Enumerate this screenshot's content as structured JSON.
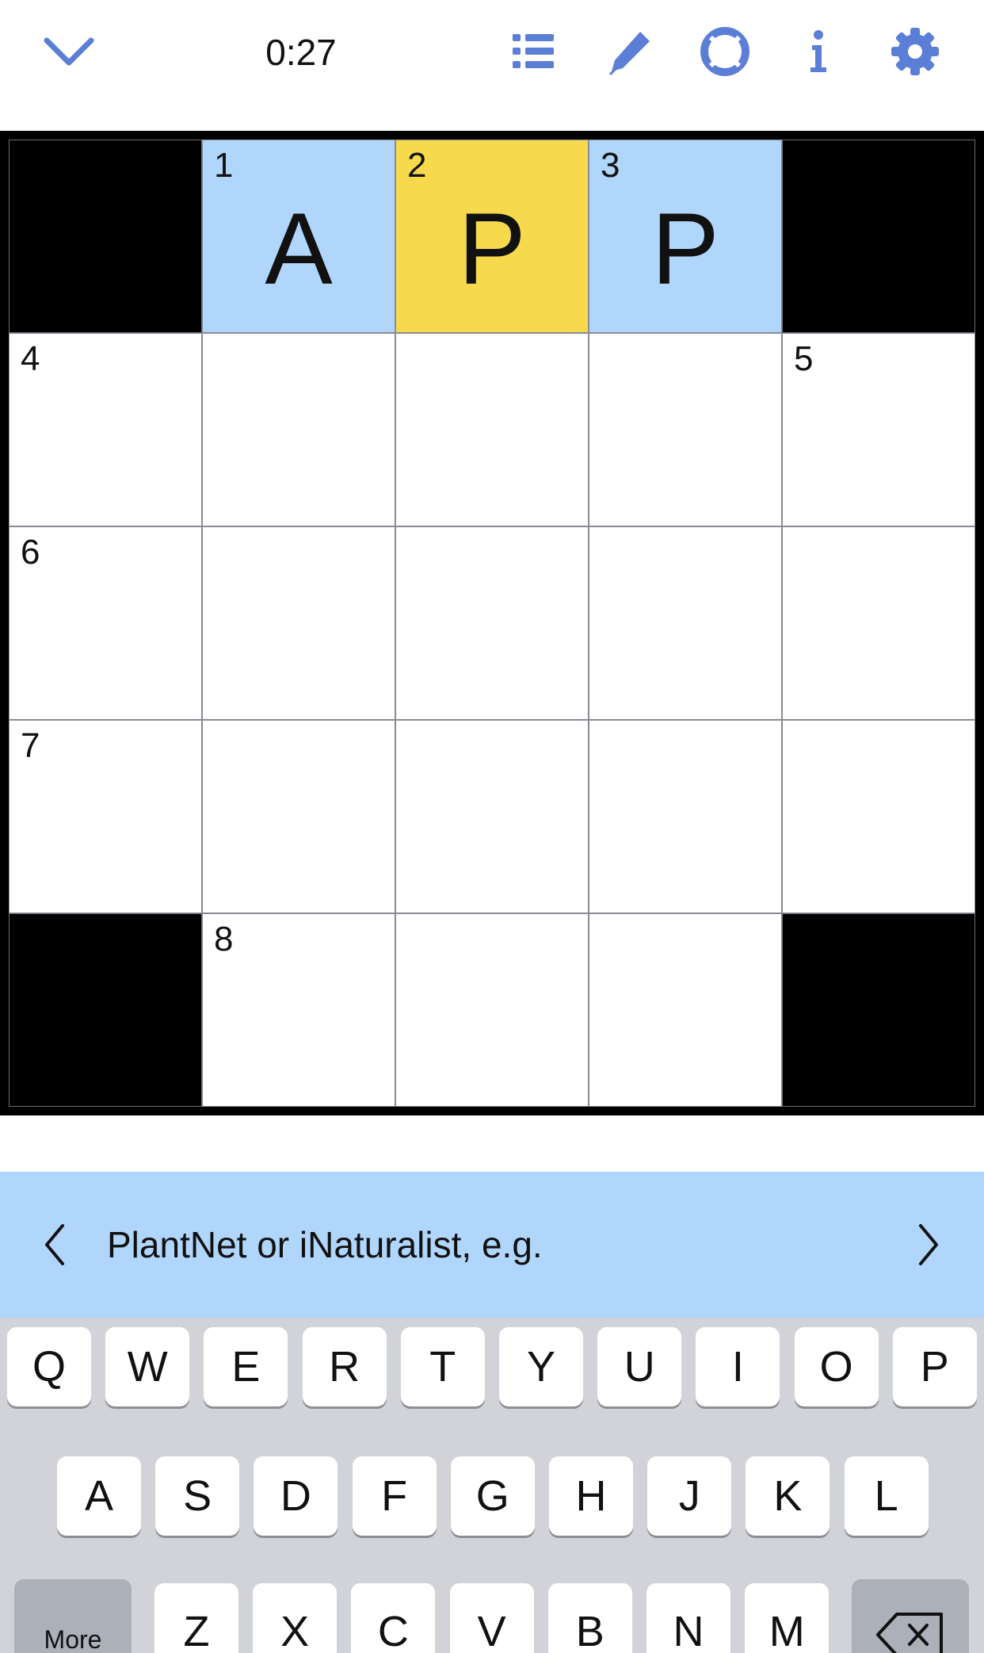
{
  "header": {
    "timer": "0:27",
    "icons": [
      "chevron-down-icon",
      "list-icon",
      "pencil-icon",
      "help-lifebuoy-icon",
      "info-icon",
      "gear-icon"
    ],
    "accent_color": "#5b7fd6"
  },
  "grid": {
    "size": 5,
    "rows": [
      [
        {
          "type": "block"
        },
        {
          "num": "1",
          "letter": "A",
          "state": "word"
        },
        {
          "num": "2",
          "letter": "P",
          "state": "focus"
        },
        {
          "num": "3",
          "letter": "P",
          "state": "word"
        },
        {
          "type": "block"
        }
      ],
      [
        {
          "num": "4"
        },
        {},
        {},
        {},
        {
          "num": "5"
        }
      ],
      [
        {
          "num": "6"
        },
        {},
        {},
        {},
        {}
      ],
      [
        {
          "num": "7"
        },
        {},
        {},
        {},
        {}
      ],
      [
        {
          "type": "block"
        },
        {
          "num": "8"
        },
        {},
        {},
        {
          "type": "block"
        }
      ]
    ],
    "colors": {
      "word": "#b1d6fb",
      "focus": "#f6d94d",
      "block": "#000000"
    }
  },
  "clue": {
    "text": "PlantNet or iNaturalist, e.g."
  },
  "keyboard": {
    "row1": [
      "Q",
      "W",
      "E",
      "R",
      "T",
      "Y",
      "U",
      "I",
      "O",
      "P"
    ],
    "row2": [
      "A",
      "S",
      "D",
      "F",
      "G",
      "H",
      "J",
      "K",
      "L"
    ],
    "row3": [
      "Z",
      "X",
      "C",
      "V",
      "B",
      "N",
      "M"
    ],
    "more_label": "More"
  }
}
